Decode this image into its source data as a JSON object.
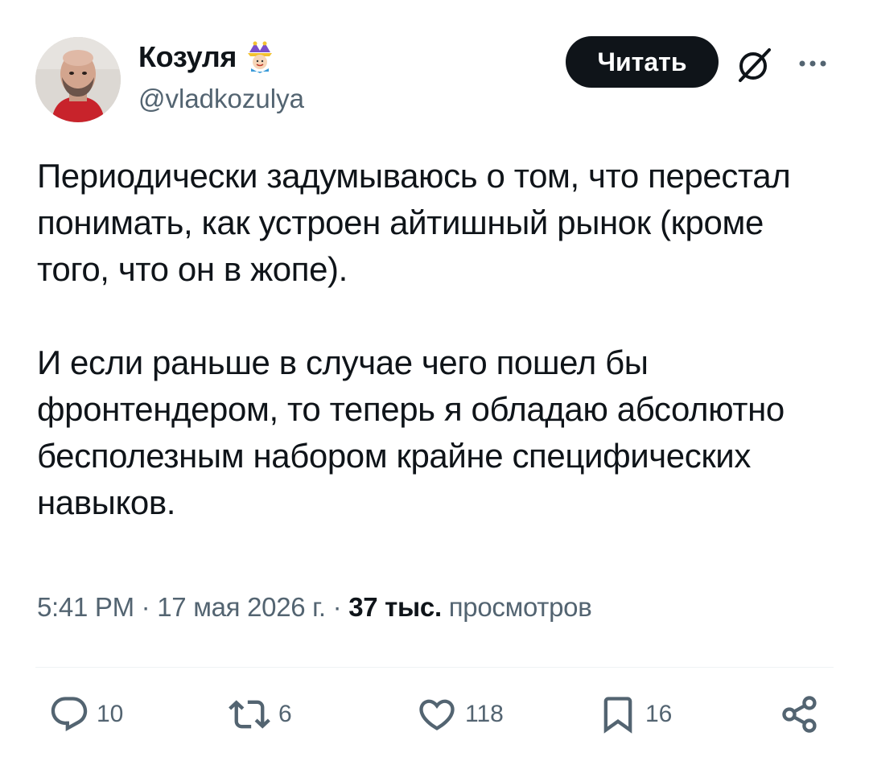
{
  "author": {
    "display_name": "Козуля",
    "badge_icon": "jester-emoji-icon",
    "handle": "@vladkozulya"
  },
  "header_actions": {
    "follow_label": "Читать",
    "grok_icon": "grok-icon",
    "more_icon": "more-icon"
  },
  "tweet": {
    "paragraphs": [
      "Периодически задумываюсь о том, что перестал понимать, как устроен айтишный рынок (кроме того, что он в жопе).",
      "И если раньше в случае чего пошел бы фронтендером, то теперь я обладаю абсолютно бесполезным набором крайне специфических навыков."
    ]
  },
  "meta": {
    "time": "5:41 PM",
    "separator": " · ",
    "date": "17 мая 2026 г.",
    "views_count": "37 тыс.",
    "views_label": "просмотров"
  },
  "actions": {
    "replies": "10",
    "reposts": "6",
    "likes": "118",
    "bookmarks": "16"
  },
  "colors": {
    "text": "#0f1419",
    "secondary": "#536471",
    "button_bg": "#0f1419",
    "divider": "#eff3f4"
  }
}
